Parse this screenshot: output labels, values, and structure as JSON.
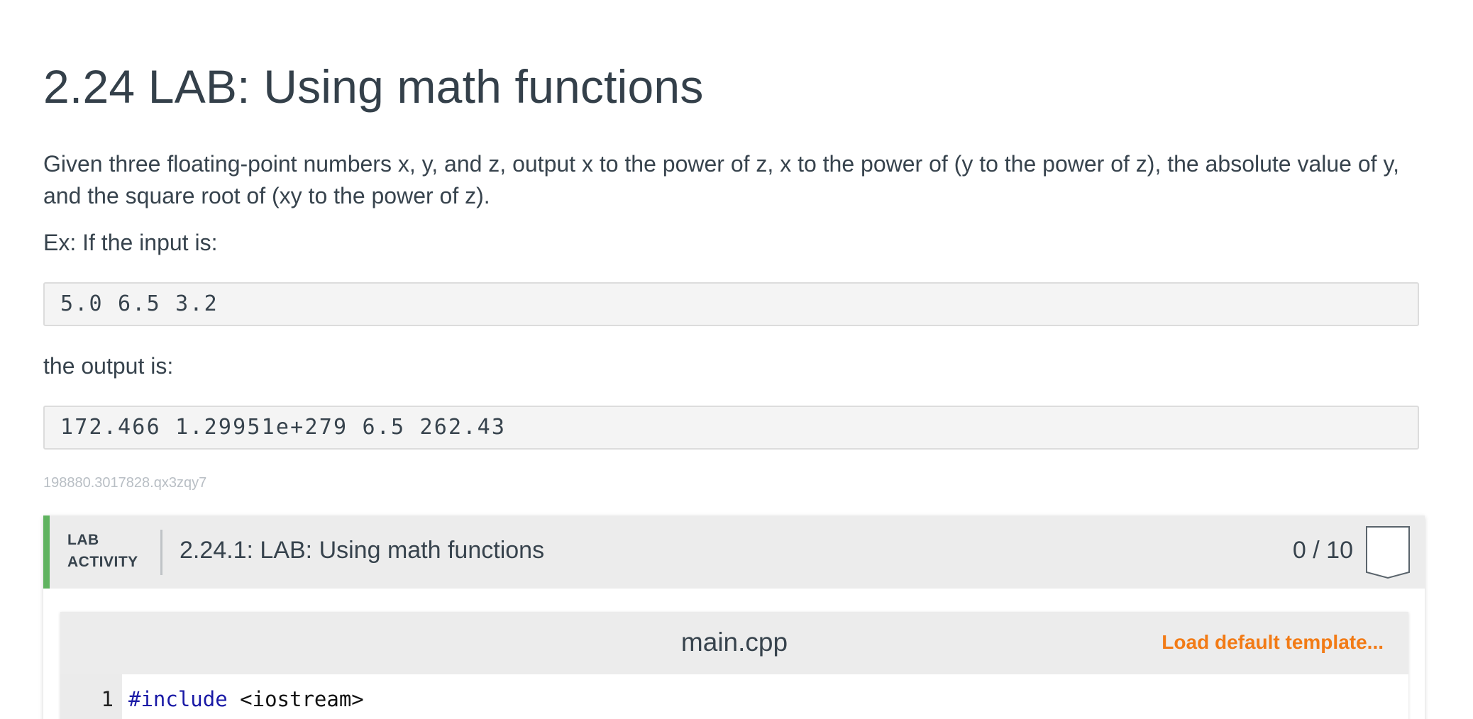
{
  "page": {
    "title": "2.24 LAB: Using math functions",
    "description": "Given three floating-point numbers x, y, and z, output x to the power of z, x to the power of (y to the power of z), the absolute value of y, and the square root of (xy to the power of z).",
    "example_intro": "Ex: If the input is:",
    "example_input": "5.0 6.5 3.2",
    "output_intro": "the output is:",
    "example_output": "172.466 1.29951e+279 6.5 262.43",
    "hash_id": "198880.3017828.qx3zqy7"
  },
  "lab_activity": {
    "tag_line1": "LAB",
    "tag_line2": "ACTIVITY",
    "title": "2.24.1: LAB: Using math functions",
    "score": "0 / 10",
    "accent_color": "#5fb35f",
    "badge_icon": "shield-outline-icon"
  },
  "editor": {
    "filename": "main.cpp",
    "load_template_label": "Load default template...",
    "link_color": "#f27b16",
    "lines": [
      {
        "number": "1",
        "keyword": "#include",
        "rest": " <iostream>"
      }
    ]
  }
}
